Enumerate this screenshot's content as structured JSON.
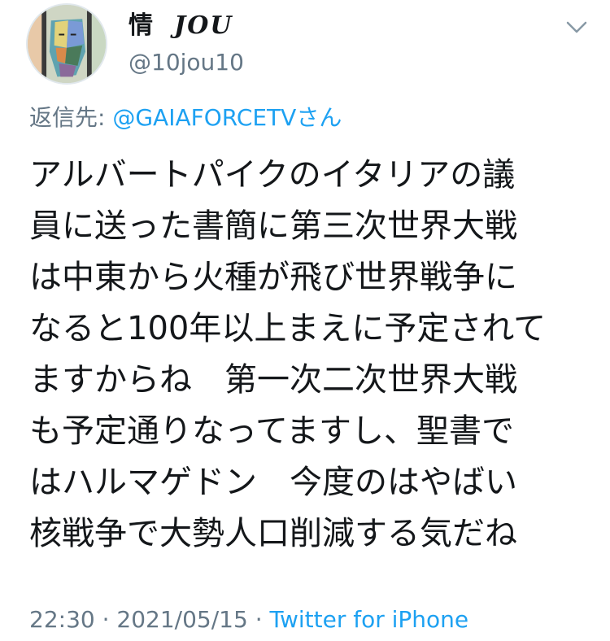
{
  "user": {
    "display_name": "情",
    "display_name_deco": "JOU",
    "handle": "@10jou10"
  },
  "reply": {
    "prefix": "返信先: ",
    "target": "@GAIAFORCETVさん"
  },
  "tweet": {
    "lines": [
      "アルバートパイクのイタリアの議",
      "員に送った書簡に第三次世界大戦",
      "は中東から火種が飛び世界戦争に",
      "なると100年以上まえに予定されて",
      "ますからね　第一次二次世界大戦",
      "も予定通りなってますし、聖書で",
      "はハルマゲドン　今度のはやばい",
      "核戦争で大勢人口削減する気だね"
    ]
  },
  "meta": {
    "time": "22:30",
    "sep1": " · ",
    "date": "2021/05/15",
    "sep2": " · ",
    "source": "Twitter for iPhone"
  },
  "colors": {
    "link": "#1da1f2",
    "muted": "#657786",
    "text": "#14171a"
  },
  "icons": {
    "menu": "chevron-down-icon",
    "avatar": "avatar-portrait"
  }
}
